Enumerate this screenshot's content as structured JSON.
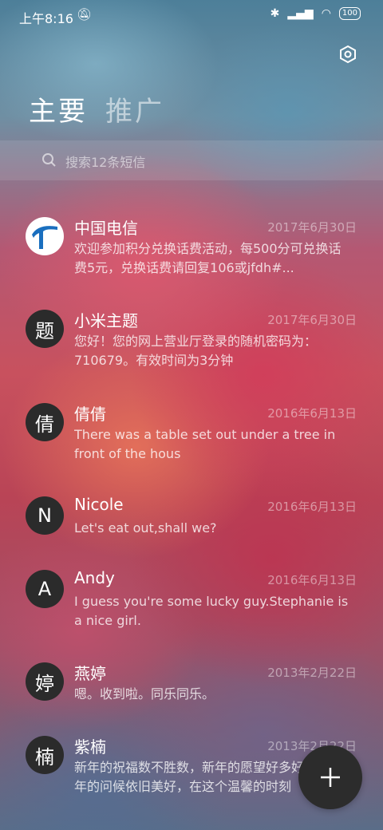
{
  "status": {
    "time": "上午8:16",
    "battery": "100"
  },
  "tabs": [
    {
      "label": "主要"
    },
    {
      "label": "推广"
    }
  ],
  "search": {
    "placeholder": "搜索12条短信"
  },
  "messages": [
    {
      "avatar": "",
      "avatar_icon": "china-telecom-logo",
      "sender": "中国电信",
      "date": "2017年6月30日",
      "preview": "欢迎参加积分兑换话费活动，每500分可兑换话费5元，兑换话费请回复106或jfdh#..."
    },
    {
      "avatar": "题",
      "sender": "小米主题",
      "date": "2017年6月30日",
      "preview": "您好！您的网上营业厅登录的随机密码为：710679。有效时间为3分钟"
    },
    {
      "avatar": "倩",
      "sender": "倩倩",
      "date": "2016年6月13日",
      "preview": "There was a table set out under a tree in front of the hous"
    },
    {
      "avatar": "N",
      "sender": "Nicole",
      "date": "2016年6月13日",
      "preview": "Let's eat out,shall we?"
    },
    {
      "avatar": "A",
      "sender": "Andy",
      "date": "2016年6月13日",
      "preview": "I guess you're some lucky guy.Stephanie is a nice girl."
    },
    {
      "avatar": "婷",
      "sender": "燕婷",
      "date": "2013年2月22日",
      "preview": "嗯。收到啦。同乐同乐。"
    },
    {
      "avatar": "楠",
      "sender": "紫楠",
      "date": "2013年2月22日",
      "preview": "新年的祝福数不胜数，新年的愿望好多好多，新年的问候依旧美好，在这个温馨的时刻"
    }
  ],
  "icons": {
    "settings": "gear-icon",
    "search": "search-icon",
    "compose": "plus-icon"
  }
}
